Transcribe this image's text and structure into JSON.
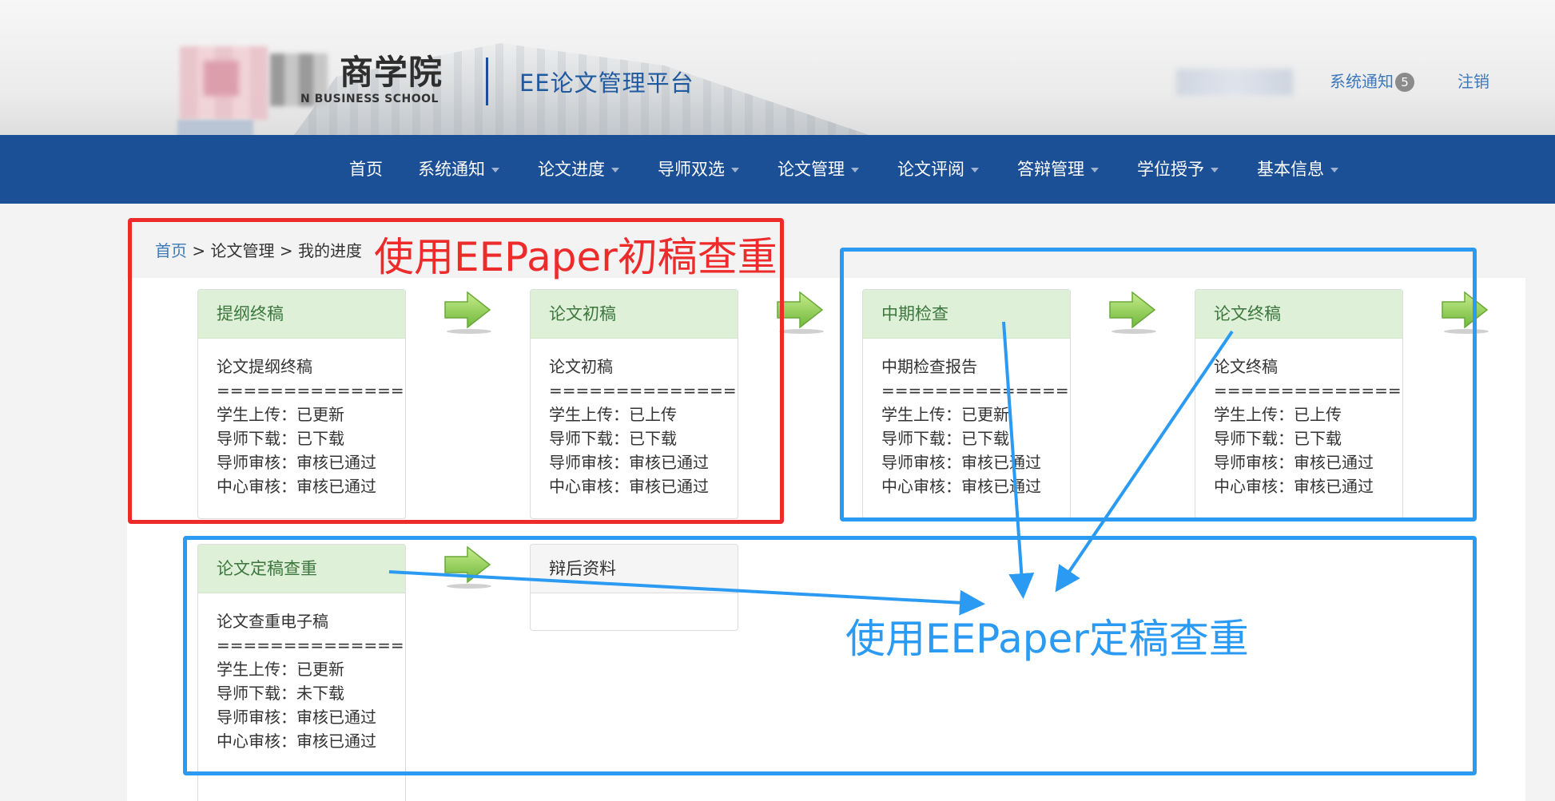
{
  "header": {
    "school_cn": "商学院",
    "school_en": "N BUSINESS SCHOOL",
    "platform_title": "EE论文管理平台",
    "system_notice_label": "系统通知",
    "system_notice_count": "5",
    "logout_label": "注销"
  },
  "nav": {
    "items": [
      {
        "label": "首页",
        "dropdown": false
      },
      {
        "label": "系统通知",
        "dropdown": true
      },
      {
        "label": "论文进度",
        "dropdown": true
      },
      {
        "label": "导师双选",
        "dropdown": true
      },
      {
        "label": "论文管理",
        "dropdown": true
      },
      {
        "label": "论文评阅",
        "dropdown": true
      },
      {
        "label": "答辩管理",
        "dropdown": true
      },
      {
        "label": "学位授予",
        "dropdown": true
      },
      {
        "label": "基本信息",
        "dropdown": true
      }
    ]
  },
  "breadcrumb": {
    "home": "首页",
    "sep": " > ",
    "level1": "论文管理",
    "level2": "我的进度"
  },
  "cards": [
    {
      "title": "提纲终稿",
      "doc": "论文提纲终稿",
      "divider": "==============",
      "rows": [
        {
          "label": "学生上传：",
          "value": "已更新"
        },
        {
          "label": "导师下载：",
          "value": "已下载"
        },
        {
          "label": "导师审核：",
          "value": "审核已通过"
        },
        {
          "label": "中心审核：",
          "value": "审核已通过"
        }
      ]
    },
    {
      "title": "论文初稿",
      "doc": "论文初稿",
      "divider": "==============",
      "rows": [
        {
          "label": "学生上传：",
          "value": "已上传"
        },
        {
          "label": "导师下载：",
          "value": "已下载"
        },
        {
          "label": "导师审核：",
          "value": "审核已通过"
        },
        {
          "label": "中心审核：",
          "value": "审核已通过"
        }
      ]
    },
    {
      "title": "中期检查",
      "doc": "中期检查报告",
      "divider": "==============",
      "rows": [
        {
          "label": "学生上传：",
          "value": "已更新"
        },
        {
          "label": "导师下载：",
          "value": "已下载"
        },
        {
          "label": "导师审核：",
          "value": "审核已通过"
        },
        {
          "label": "中心审核：",
          "value": "审核已通过"
        }
      ]
    },
    {
      "title": "论文终稿",
      "doc": "论文终稿",
      "divider": "==============",
      "rows": [
        {
          "label": "学生上传：",
          "value": "已上传"
        },
        {
          "label": "导师下载：",
          "value": "已下载"
        },
        {
          "label": "导师审核：",
          "value": "审核已通过"
        },
        {
          "label": "中心审核：",
          "value": "审核已通过"
        }
      ]
    },
    {
      "title": "论文定稿查重",
      "doc": "论文查重电子稿",
      "divider": "==============",
      "rows": [
        {
          "label": "学生上传：",
          "value": "已更新"
        },
        {
          "label": "导师下载：",
          "value": "未下载"
        },
        {
          "label": "导师审核：",
          "value": "审核已通过"
        },
        {
          "label": "中心审核：",
          "value": "审核已通过"
        }
      ]
    },
    {
      "title": "辩后资料"
    }
  ],
  "annotations": {
    "red_label": "使用EEPaper初稿查重",
    "blue_label": "使用EEPaper定稿查重",
    "red_color": "#ee2b2b",
    "blue_color": "#2b9af2"
  },
  "colors": {
    "nav_bg": "#1b4f96",
    "card_head_active": "#dff0d8",
    "card_head_text": "#3c763d",
    "link": "#3c79ba"
  }
}
